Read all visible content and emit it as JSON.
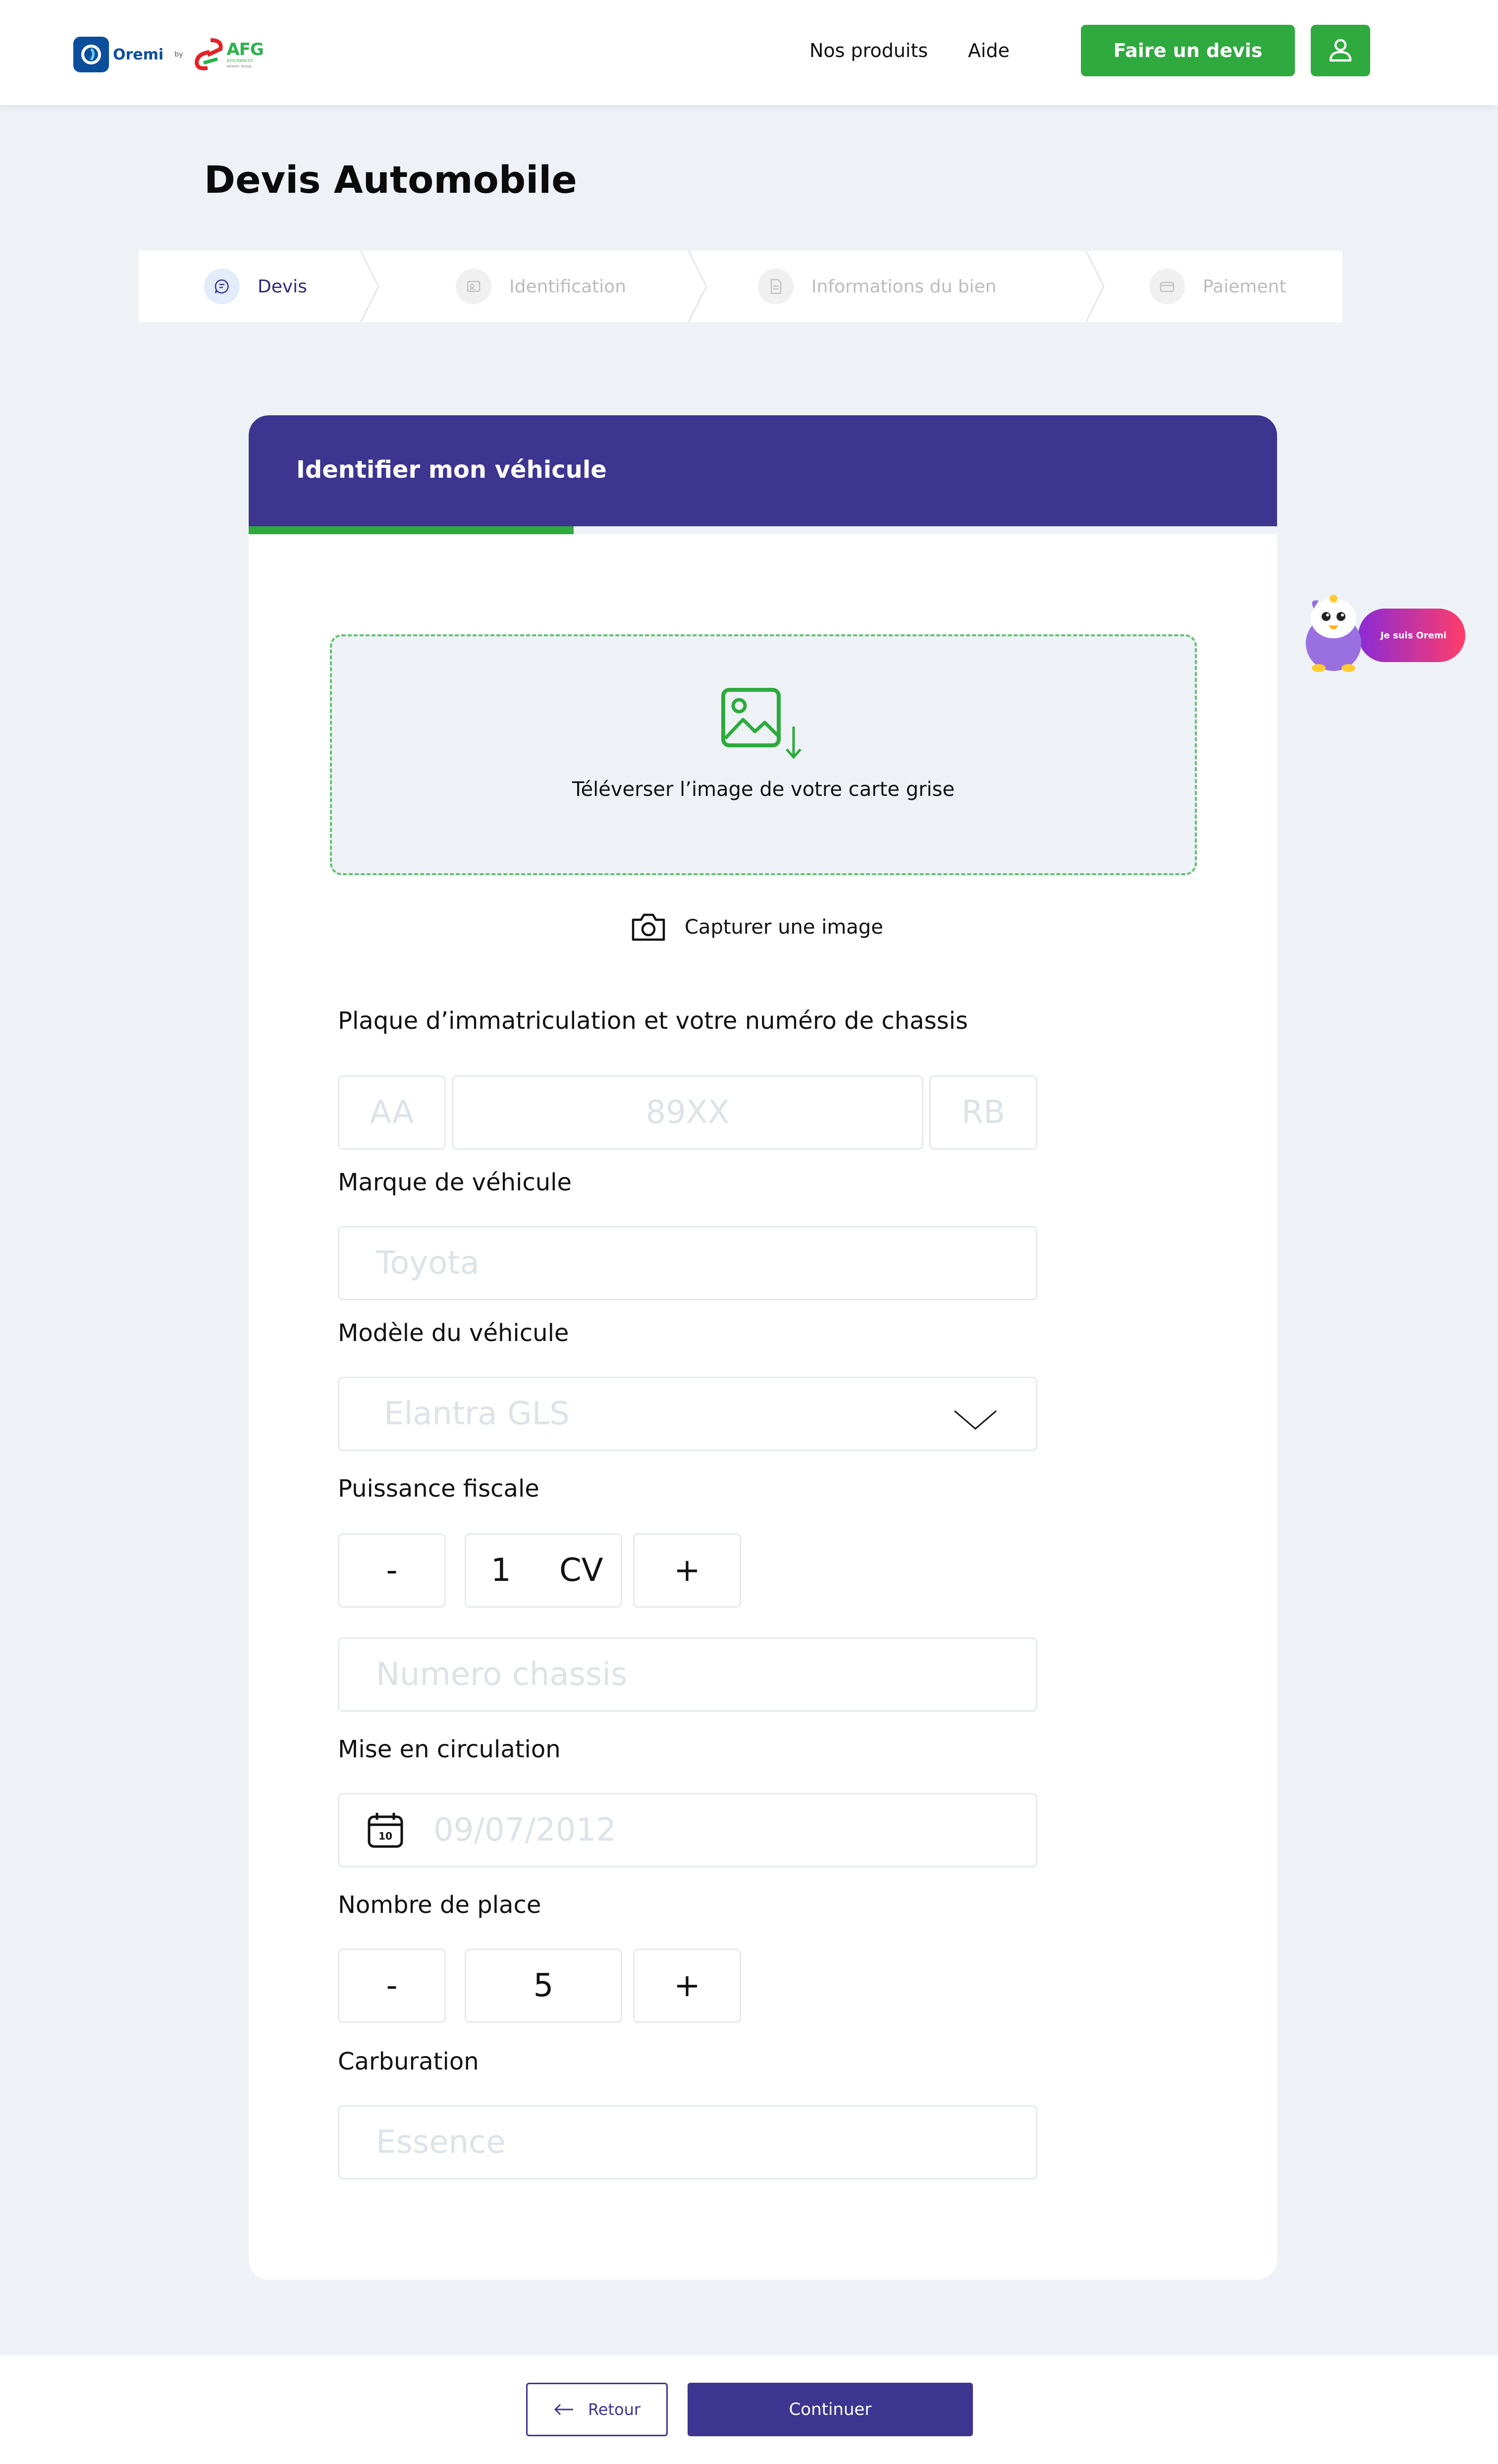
{
  "header": {
    "logo": {
      "oremi": "Oremi",
      "by": "by",
      "afg": "AFG",
      "afg_sub": "ASSURANCES",
      "afg_group": "Atlantic Group"
    },
    "nav": {
      "products": "Nos produits",
      "help": "Aide"
    },
    "cta_label": "Faire un devis",
    "user_icon": "user-icon"
  },
  "page_title": "Devis Automobile",
  "stepper": [
    {
      "label": "Devis",
      "active": true,
      "icon": "chat-icon"
    },
    {
      "label": "Identification",
      "active": false,
      "icon": "id-card-icon"
    },
    {
      "label": "Informations du bien",
      "active": false,
      "icon": "document-icon"
    },
    {
      "label": "Paiement",
      "active": false,
      "icon": "wallet-icon"
    }
  ],
  "card": {
    "title": "Identifier mon véhicule",
    "progress": 0.316,
    "upload_text": "Téléverser l’image de votre carte grise",
    "capture_text": "Capturer une image",
    "plate": {
      "label": "Plaque d’immatriculation et votre numéro de chassis",
      "part1_placeholder": "AA",
      "part2_placeholder": "89XX",
      "part3_placeholder": "RB"
    },
    "brand": {
      "label": "Marque de véhicule",
      "placeholder": "Toyota"
    },
    "model": {
      "label": "Modèle du véhicule",
      "placeholder": "Elantra GLS"
    },
    "fiscal_power": {
      "label": "Puissance fiscale",
      "minus": "-",
      "value": "1",
      "unit": "CV",
      "plus": "+"
    },
    "chassis": {
      "placeholder": "Numero chassis"
    },
    "circulation": {
      "label": "Mise en circulation",
      "placeholder": "09/07/2012",
      "calendar_day": "10"
    },
    "seats": {
      "label": "Nombre de place",
      "minus": "-",
      "value": "5",
      "plus": "+"
    },
    "fuel": {
      "label": "Carburation",
      "placeholder": "Essence"
    }
  },
  "mascot": {
    "label": "Je suis Oremi"
  },
  "footer": {
    "back_label": "Retour",
    "continue_label": "Continuer"
  },
  "colors": {
    "primary": "#3d3590",
    "accent": "#2faa3e",
    "background": "#eef2f6"
  }
}
